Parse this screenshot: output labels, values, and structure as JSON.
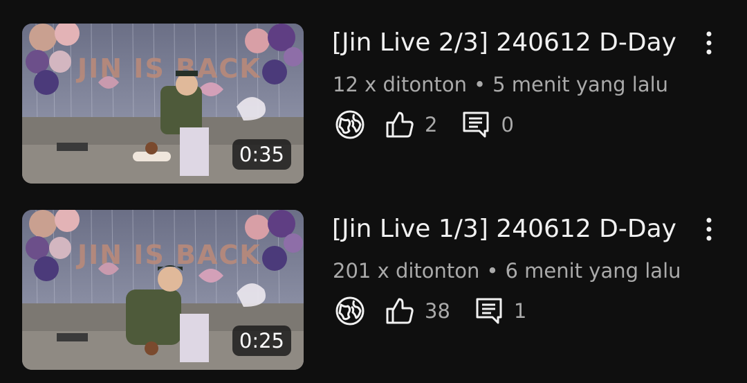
{
  "videos": [
    {
      "duration": "0:35",
      "title": "[Jin Live 2/3] 240612 D-Day",
      "views": "12 x ditonton",
      "separator": "•",
      "time_ago": "5 menit yang lalu",
      "likes": "2",
      "comments": "0",
      "visibility_icon": "globe-icon",
      "menu_icon": "more-vertical-icon"
    },
    {
      "duration": "0:25",
      "title": "[Jin Live 1/3] 240612 D-Day",
      "views": "201 x ditonton",
      "separator": "•",
      "time_ago": "6 menit yang lalu",
      "likes": "38",
      "comments": "1",
      "visibility_icon": "globe-icon",
      "menu_icon": "more-vertical-icon"
    }
  ],
  "thumbnail_banner_text": "JIN IS BACK",
  "colors": {
    "background": "#0f0f0f",
    "primary_text": "#f1f1f1",
    "secondary_text": "#aaaaaa"
  }
}
